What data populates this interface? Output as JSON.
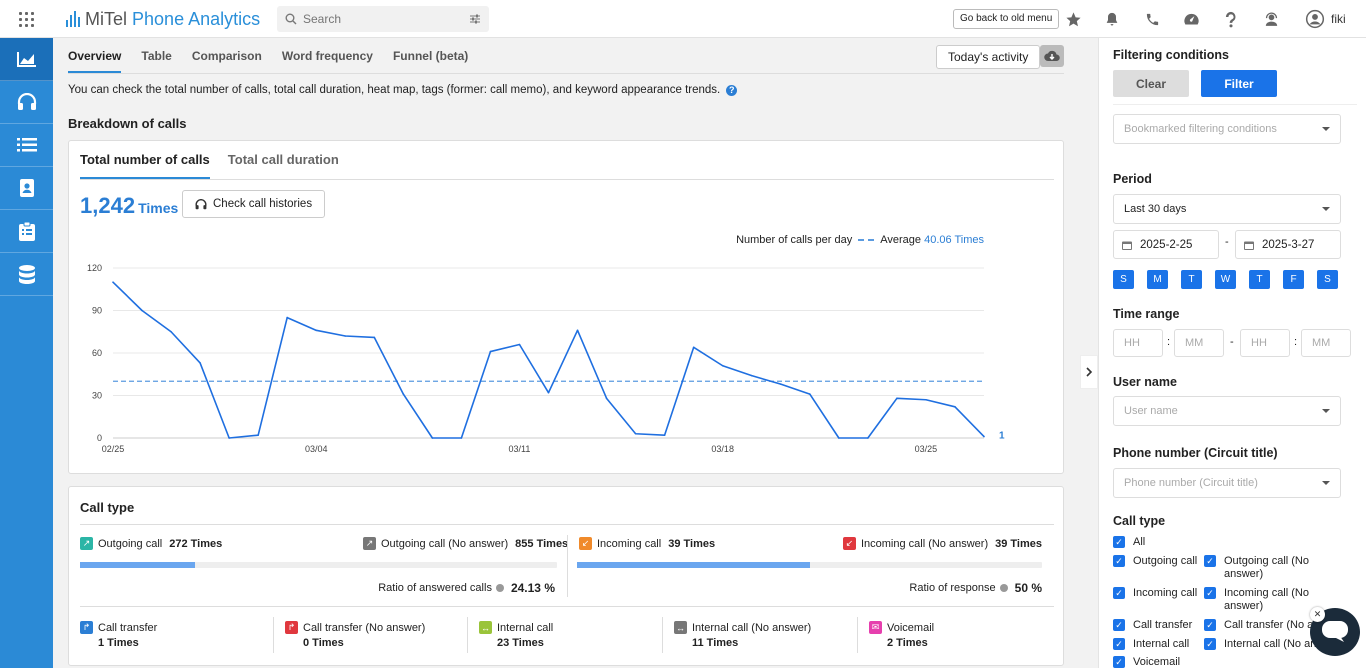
{
  "app": {
    "brand_mitel": "MiTel",
    "brand_phone": "Phone",
    "brand_analytics": "Analytics"
  },
  "header": {
    "search_placeholder": "Search",
    "old_menu": "Go back to old menu",
    "user": "fiki"
  },
  "sidebar": [
    "chart-icon",
    "headset-icon",
    "list-icon",
    "contacts-icon",
    "clipboard-icon",
    "database-icon"
  ],
  "tabs": [
    "Overview",
    "Table",
    "Comparison",
    "Word frequency",
    "Funnel (beta)"
  ],
  "todays_activity": "Today's activity",
  "description": "You can check the total number of calls, total call duration, heat map, tags (former: call memo), and keyword appearance trends.",
  "breakdown_title": "Breakdown of calls",
  "subtabs": [
    "Total number of calls",
    "Total call duration"
  ],
  "total": {
    "value": "1,242",
    "unit": "Times"
  },
  "check_histories": "Check call histories",
  "legend": {
    "series": "Number of calls per day",
    "avg_label": "Average",
    "avg_value": "40.06 Times"
  },
  "chart_data": {
    "type": "line",
    "ylim": [
      0,
      120
    ],
    "yticks": [
      0,
      30,
      60,
      90,
      120
    ],
    "xtick_labels": [
      "02/25",
      "03/04",
      "03/11",
      "03/18",
      "03/25"
    ],
    "xtick_index": [
      0,
      7,
      14,
      21,
      28
    ],
    "values": [
      110,
      90,
      75,
      53,
      0,
      2,
      85,
      76,
      72,
      71,
      31,
      0,
      0,
      61,
      66,
      32,
      76,
      28,
      3,
      2,
      64,
      51,
      44,
      38,
      31,
      0,
      0,
      28,
      27,
      22,
      1
    ],
    "average": 40.06,
    "last_label": "1",
    "colors": {
      "line": "#1f6fe0",
      "avg": "#5b9be0"
    }
  },
  "call_type": {
    "title": "Call type",
    "outgoing": {
      "label": "Outgoing call",
      "count": "272 Times"
    },
    "outgoing_na": {
      "label": "Outgoing call (No answer)",
      "count": "855 Times"
    },
    "incoming": {
      "label": "Incoming call",
      "count": "39 Times"
    },
    "incoming_na": {
      "label": "Incoming call (No answer)",
      "count": "39 Times"
    },
    "ratio_answered": {
      "label": "Ratio of answered calls",
      "value": "24.13 %",
      "fraction": 0.2413
    },
    "ratio_response": {
      "label": "Ratio of response",
      "value": "50 %",
      "fraction": 0.5
    },
    "others": [
      {
        "label": "Call transfer",
        "count": "1 Times"
      },
      {
        "label": "Call transfer (No answer)",
        "count": "0 Times"
      },
      {
        "label": "Internal call",
        "count": "23 Times"
      },
      {
        "label": "Internal call (No answer)",
        "count": "11 Times"
      },
      {
        "label": "Voicemail",
        "count": "2 Times"
      }
    ]
  },
  "panel": {
    "title": "Filtering conditions",
    "clear": "Clear",
    "filter": "Filter",
    "bookmarked": "Bookmarked filtering conditions",
    "period_title": "Period",
    "period": "Last 30 days",
    "date_from": "2025-2-25",
    "date_to": "2025-3-27",
    "days": [
      "S",
      "M",
      "T",
      "W",
      "T",
      "F",
      "S"
    ],
    "time_title": "Time range",
    "hh": "HH",
    "mm": "MM",
    "user_title": "User name",
    "user_ph": "User name",
    "phone_title": "Phone number (Circuit title)",
    "phone_ph": "Phone number (Circuit title)",
    "calltype_title": "Call type",
    "cb": {
      "all": "All",
      "outgoing": "Outgoing call",
      "outgoing_na_1": "Outgoing call (No",
      "outgoing_na_2": "answer)",
      "incoming": "Incoming call",
      "incoming_na_1": "Incoming call (No",
      "incoming_na_2": "answer)",
      "transfer": "Call transfer",
      "transfer_na": "Call transfer (No ar",
      "internal": "Internal call",
      "internal_na": "Internal call (No ans",
      "voicemail": "Voicemail"
    }
  }
}
